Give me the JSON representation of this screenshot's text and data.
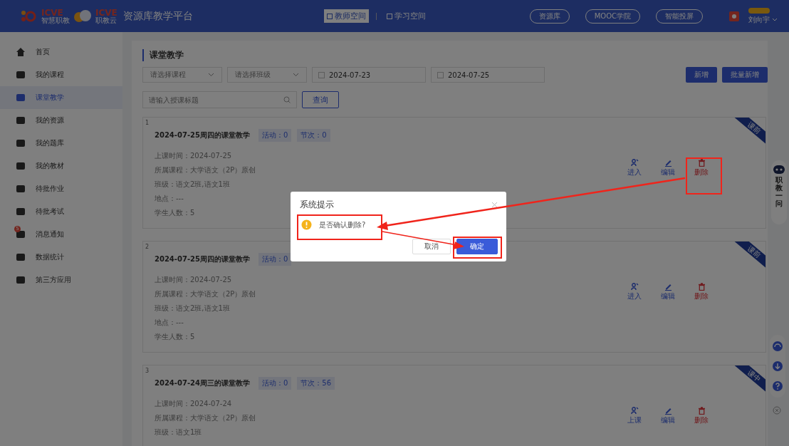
{
  "header": {
    "logo_text": "ICVE",
    "logo_subtitle": "智慧职教",
    "logo2_text": "ICVE",
    "logo2_subtitle": "职教云",
    "platform_title": "资源库教学平台",
    "spaces": [
      {
        "label": "教师空间",
        "selected": true
      },
      {
        "label": "学习空间",
        "selected": false
      }
    ],
    "links": [
      "资源库",
      "MOOC学院",
      "智能投屏"
    ],
    "user": {
      "name": "刘向宇"
    }
  },
  "sidebar": {
    "items": [
      {
        "label": "首页",
        "selected": false
      },
      {
        "label": "我的课程",
        "selected": false
      },
      {
        "label": "课堂教学",
        "selected": true
      },
      {
        "label": "我的资源",
        "selected": false
      },
      {
        "label": "我的题库",
        "selected": false
      },
      {
        "label": "我的教材",
        "selected": false
      },
      {
        "label": "待批作业",
        "selected": false
      },
      {
        "label": "待批考试",
        "selected": false
      },
      {
        "label": "消息通知",
        "selected": false,
        "badge": "5"
      },
      {
        "label": "数据统计",
        "selected": false
      },
      {
        "label": "第三方应用",
        "selected": false
      }
    ]
  },
  "page": {
    "title": "课堂教学",
    "filters": {
      "course": {
        "placeholder": "请选择课程"
      },
      "class": {
        "placeholder": "请选择班级"
      },
      "start_date": "2024-07-23",
      "end_date": "2024-07-25",
      "search": {
        "placeholder": "请输入授课标题"
      },
      "query_button": "查询"
    },
    "buttons": [
      "新增",
      "批量新增"
    ],
    "cards": [
      {
        "index": "1",
        "title": "2024-07-25周四的课堂教学",
        "tags": [
          "活动：0",
          "节次：0"
        ],
        "status": "课前",
        "info": [
          "上课时间：2024-07-25",
          "所属课程：大学语文（2P）原创",
          "班级：语文2班,语文1班",
          "地点：---",
          "学生人数：5"
        ],
        "actions": [
          {
            "kind": "enter",
            "label": "进入"
          },
          {
            "kind": "edit",
            "label": "编辑"
          },
          {
            "kind": "delete",
            "label": "删除"
          }
        ]
      },
      {
        "index": "2",
        "title": "2024-07-25周四的课堂教学",
        "tags": [
          "活动：0"
        ],
        "status": "课前",
        "info": [
          "上课时间：2024-07-25",
          "所属课程：大学语文（2P）原创",
          "班级：语文2班,语文1班",
          "地点：---",
          "学生人数：5"
        ],
        "actions": [
          {
            "kind": "enter",
            "label": "进入"
          },
          {
            "kind": "edit",
            "label": "编辑"
          },
          {
            "kind": "delete",
            "label": "删除"
          }
        ]
      },
      {
        "index": "3",
        "title": "2024-07-24周三的课堂教学",
        "tags": [
          "活动：0",
          "节次：56"
        ],
        "status": "课中",
        "info": [
          "上课时间：2024-07-24",
          "所属课程：大学语文（2P）原创",
          "班级：语文1班"
        ],
        "actions": [
          {
            "kind": "enter",
            "label": "上课"
          },
          {
            "kind": "edit",
            "label": "编辑"
          },
          {
            "kind": "delete",
            "label": "删除"
          }
        ]
      }
    ]
  },
  "assistant": {
    "label": "职教一问"
  },
  "dialog": {
    "title": "系统提示",
    "message": "是否确认删除?",
    "buttons": [
      {
        "label": "取消",
        "kind": "secondary"
      },
      {
        "label": "确定",
        "kind": "primary"
      }
    ]
  }
}
